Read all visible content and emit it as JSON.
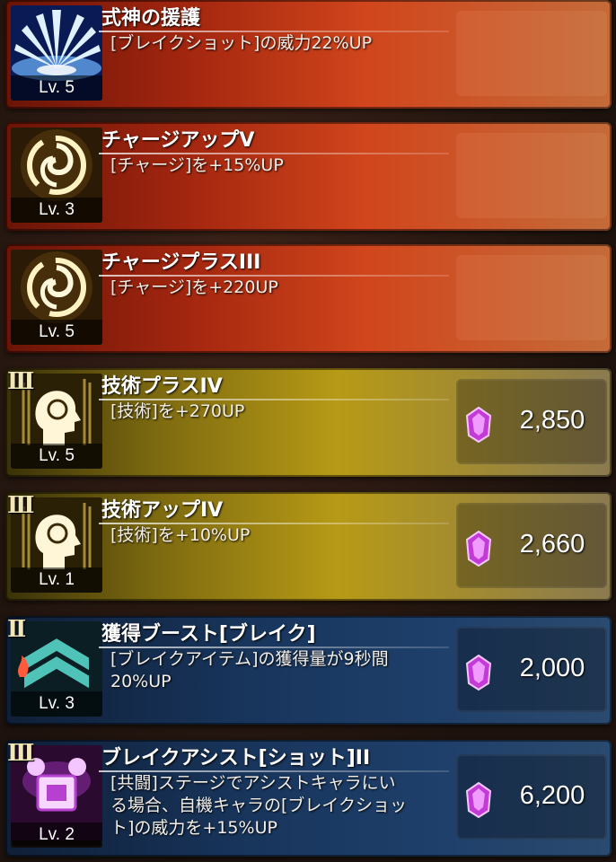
{
  "colors": {
    "red_card": "#a3260f",
    "gold_card": "#b79a16",
    "blue_card": "#18355c",
    "gem": "#d24fe0"
  },
  "skills": [
    {
      "name": "式神の援護",
      "desc": "[ブレイクショット]の威力22%UP",
      "level": "Lv. 5",
      "rank": "",
      "price": "",
      "icon": "ice-burst-icon",
      "style": "red"
    },
    {
      "name": "チャージアップV",
      "desc": "[チャージ]を+15%UP",
      "level": "Lv. 3",
      "rank": "",
      "price": "",
      "icon": "swirl-icon",
      "style": "red"
    },
    {
      "name": "チャージプラスIII",
      "desc": "[チャージ]を+220UP",
      "level": "Lv. 5",
      "rank": "",
      "price": "",
      "icon": "swirl-icon",
      "style": "red"
    },
    {
      "name": "技術プラスIV",
      "desc": "[技術]を+270UP",
      "level": "Lv. 5",
      "rank": "III",
      "price": "2,850",
      "icon": "head-profile-icon",
      "style": "gold"
    },
    {
      "name": "技術アップIV",
      "desc": "[技術]を+10%UP",
      "level": "Lv. 1",
      "rank": "III",
      "price": "2,660",
      "icon": "head-profile-icon",
      "style": "gold"
    },
    {
      "name": "獲得ブースト[ブレイク]",
      "desc": "[ブレイクアイテム]の獲得量が9秒間\n20%UP",
      "level": "Lv. 3",
      "rank": "II",
      "price": "2,000",
      "icon": "chevron-rank-icon",
      "style": "blue"
    },
    {
      "name": "ブレイクアシスト[ショット]II",
      "desc": "[共闘]ステージでアシストキャラにい\nる場合、自機キャラの[ブレイクショッ\nト]の威力を+15%UP",
      "level": "Lv. 2",
      "rank": "III",
      "price": "6,200",
      "icon": "assist-emblem-icon",
      "style": "blue"
    }
  ]
}
